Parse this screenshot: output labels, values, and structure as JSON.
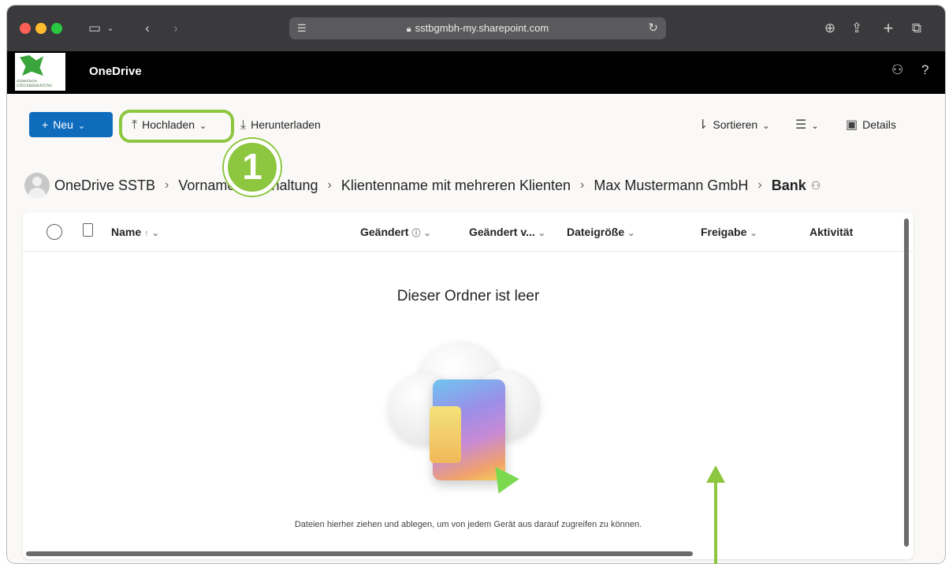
{
  "browser": {
    "url": "sstbgmbh-my.sharepoint.com",
    "icons": [
      "sidebar-icon",
      "chevron-down-icon",
      "back-icon",
      "forward-icon",
      "page-icon",
      "lock-icon",
      "reload-icon",
      "download-icon",
      "share-icon",
      "new-tab-icon",
      "tabs-overview-icon"
    ]
  },
  "header": {
    "app_title": "OneDrive",
    "logo_text_line1": "südsteirische",
    "logo_text_line2": "STEUERBERATUNG",
    "help": "?"
  },
  "commandbar": {
    "new_label": "Neu",
    "upload_label": "Hochladen",
    "download_label": "Herunterladen",
    "sort_label": "Sortieren",
    "details_label": "Details"
  },
  "annotation": {
    "badge_number": "1"
  },
  "breadcrumb": {
    "items": [
      "OneDrive SSTB",
      "Vorname Buchhaltung",
      "Klientenname mit mehreren Klienten",
      "Max Mustermann GmbH",
      "Bank"
    ]
  },
  "columns": {
    "name": "Name",
    "modified": "Geändert",
    "modified_by": "Geändert v...",
    "file_size": "Dateigröße",
    "sharing": "Freigabe",
    "activity": "Aktivität"
  },
  "empty_state": {
    "title": "Dieser Ordner ist leer",
    "text": "Dateien hierher ziehen und ablegen, um von jedem Gerät aus darauf zugreifen zu können."
  },
  "colors": {
    "accent": "#0f6cbd",
    "annotation": "#8dc63f"
  }
}
